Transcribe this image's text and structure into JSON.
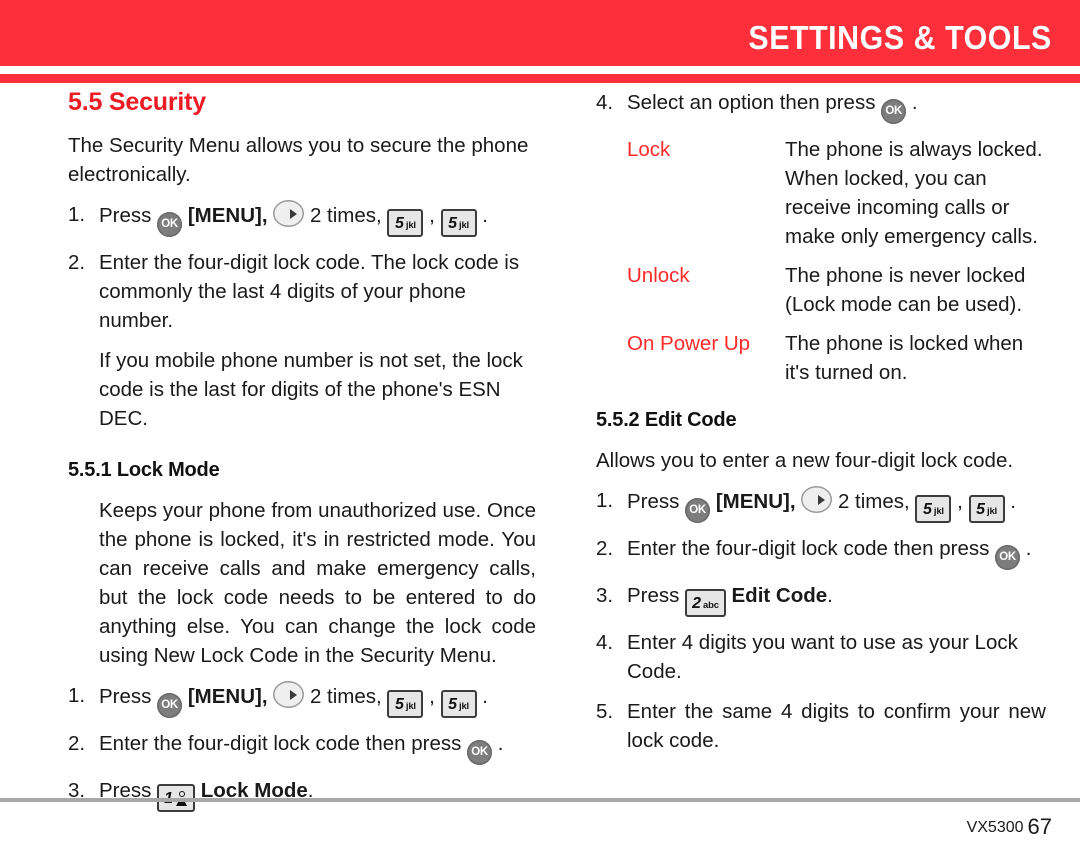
{
  "header": {
    "title": "SETTINGS & TOOLS",
    "band_color": "#fc2f3b"
  },
  "accent_color": "#ed1c24",
  "left_column": {
    "section_title": "5.5 Security",
    "intro": "The Security Menu allows you to secure the phone electronically.",
    "steps": [
      {
        "num": "1.",
        "pre": "Press",
        "menu_label": "[MENU],",
        "times_label": "2 times,",
        "key1": {
          "digit": "5",
          "letters": "jkl"
        },
        "key2": {
          "digit": "5",
          "letters": "jkl"
        },
        "post": "."
      },
      {
        "num": "2.",
        "text": "Enter the four-digit lock code. The lock code is commonly the last 4 digits of your phone number."
      }
    ],
    "step2_continued": "If you mobile phone number is not set, the lock code is the last for digits of the phone's ESN DEC.",
    "subsection_title": "5.5.1 Lock Mode",
    "lock_mode_body": "Keeps your phone from unauthorized use. Once the phone is locked, it's in restricted mode. You can receive calls and make emergency calls, but the lock code needs to be entered to do anything else. You can change the lock code using New Lock Code in the Security Menu.",
    "lock_steps": [
      {
        "num": "1.",
        "pre": "Press",
        "menu_label": "[MENU],",
        "times_label": "2 times,",
        "key1": {
          "digit": "5",
          "letters": "jkl"
        },
        "key2": {
          "digit": "5",
          "letters": "jkl"
        },
        "post": "."
      },
      {
        "num": "2.",
        "pre": "Enter the four-digit lock code then press",
        "post": "."
      },
      {
        "num": "3.",
        "pre": "Press",
        "key": {
          "digit": "1",
          "letters": ""
        },
        "bold_label": "Lock Mode",
        "post": "."
      }
    ]
  },
  "right_column": {
    "step4": {
      "num": "4.",
      "pre": "Select an option then press",
      "post": "."
    },
    "options": [
      {
        "term": "Lock",
        "desc": "The phone is always locked. When locked, you can receive incoming calls or make only emergency calls."
      },
      {
        "term": "Unlock",
        "desc": "The phone is never locked (Lock mode can be used)."
      },
      {
        "term": "On Power Up",
        "desc": "The phone is locked when it's turned on."
      }
    ],
    "subsection_title": "5.5.2 Edit Code",
    "edit_code_intro": "Allows you to enter a new four-digit lock code.",
    "edit_steps": [
      {
        "num": "1.",
        "pre": "Press",
        "menu_label": "[MENU],",
        "times_label": "2 times,",
        "key1": {
          "digit": "5",
          "letters": "jkl"
        },
        "key2": {
          "digit": "5",
          "letters": "jkl"
        },
        "post": "."
      },
      {
        "num": "2.",
        "pre": "Enter the four-digit lock code then press",
        "post": "."
      },
      {
        "num": "3.",
        "pre": "Press",
        "key": {
          "digit": "2",
          "letters": "abc"
        },
        "bold_label": "Edit Code",
        "post": "."
      },
      {
        "num": "4.",
        "text": "Enter 4 digits you want to use as your Lock Code."
      },
      {
        "num": "5.",
        "text": "Enter the same 4 digits to confirm your new lock code."
      }
    ]
  },
  "footer": {
    "model": "VX5300",
    "page_number": "67"
  },
  "icons": {
    "ok_key": "OK",
    "nav_key": "nav-right-arrow"
  }
}
